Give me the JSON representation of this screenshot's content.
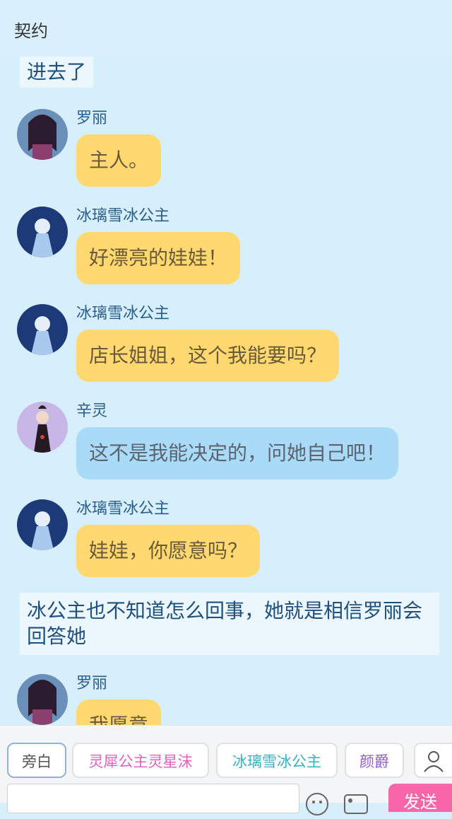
{
  "header": {
    "title": "契约"
  },
  "chat": {
    "narration_1": "进去了",
    "narration_2": "冰公主也不知道怎么回事，她就是相信罗丽会回答她",
    "messages": [
      {
        "name": "罗丽",
        "text": "主人。",
        "color": "#ffd970"
      },
      {
        "name": "冰璃雪冰公主",
        "text": "好漂亮的娃娃！",
        "color": "#ffd970"
      },
      {
        "name": "冰璃雪冰公主",
        "text": "店长姐姐，这个我能要吗？",
        "color": "#ffd970"
      },
      {
        "name": "辛灵",
        "text": "这不是我能决定的，问她自己吧！",
        "color": "#a9daf8"
      },
      {
        "name": "冰璃雪冰公主",
        "text": "娃娃，你愿意吗？",
        "color": "#ffd970"
      },
      {
        "name": "罗丽",
        "text": "我愿意",
        "color": "#ffd970"
      }
    ]
  },
  "bottom": {
    "roles": [
      {
        "label": "旁白"
      },
      {
        "label": "灵犀公主灵星沫"
      },
      {
        "label": "冰璃雪冰公主"
      },
      {
        "label": "颜爵"
      }
    ],
    "send_label": "发送",
    "input_value": ""
  }
}
